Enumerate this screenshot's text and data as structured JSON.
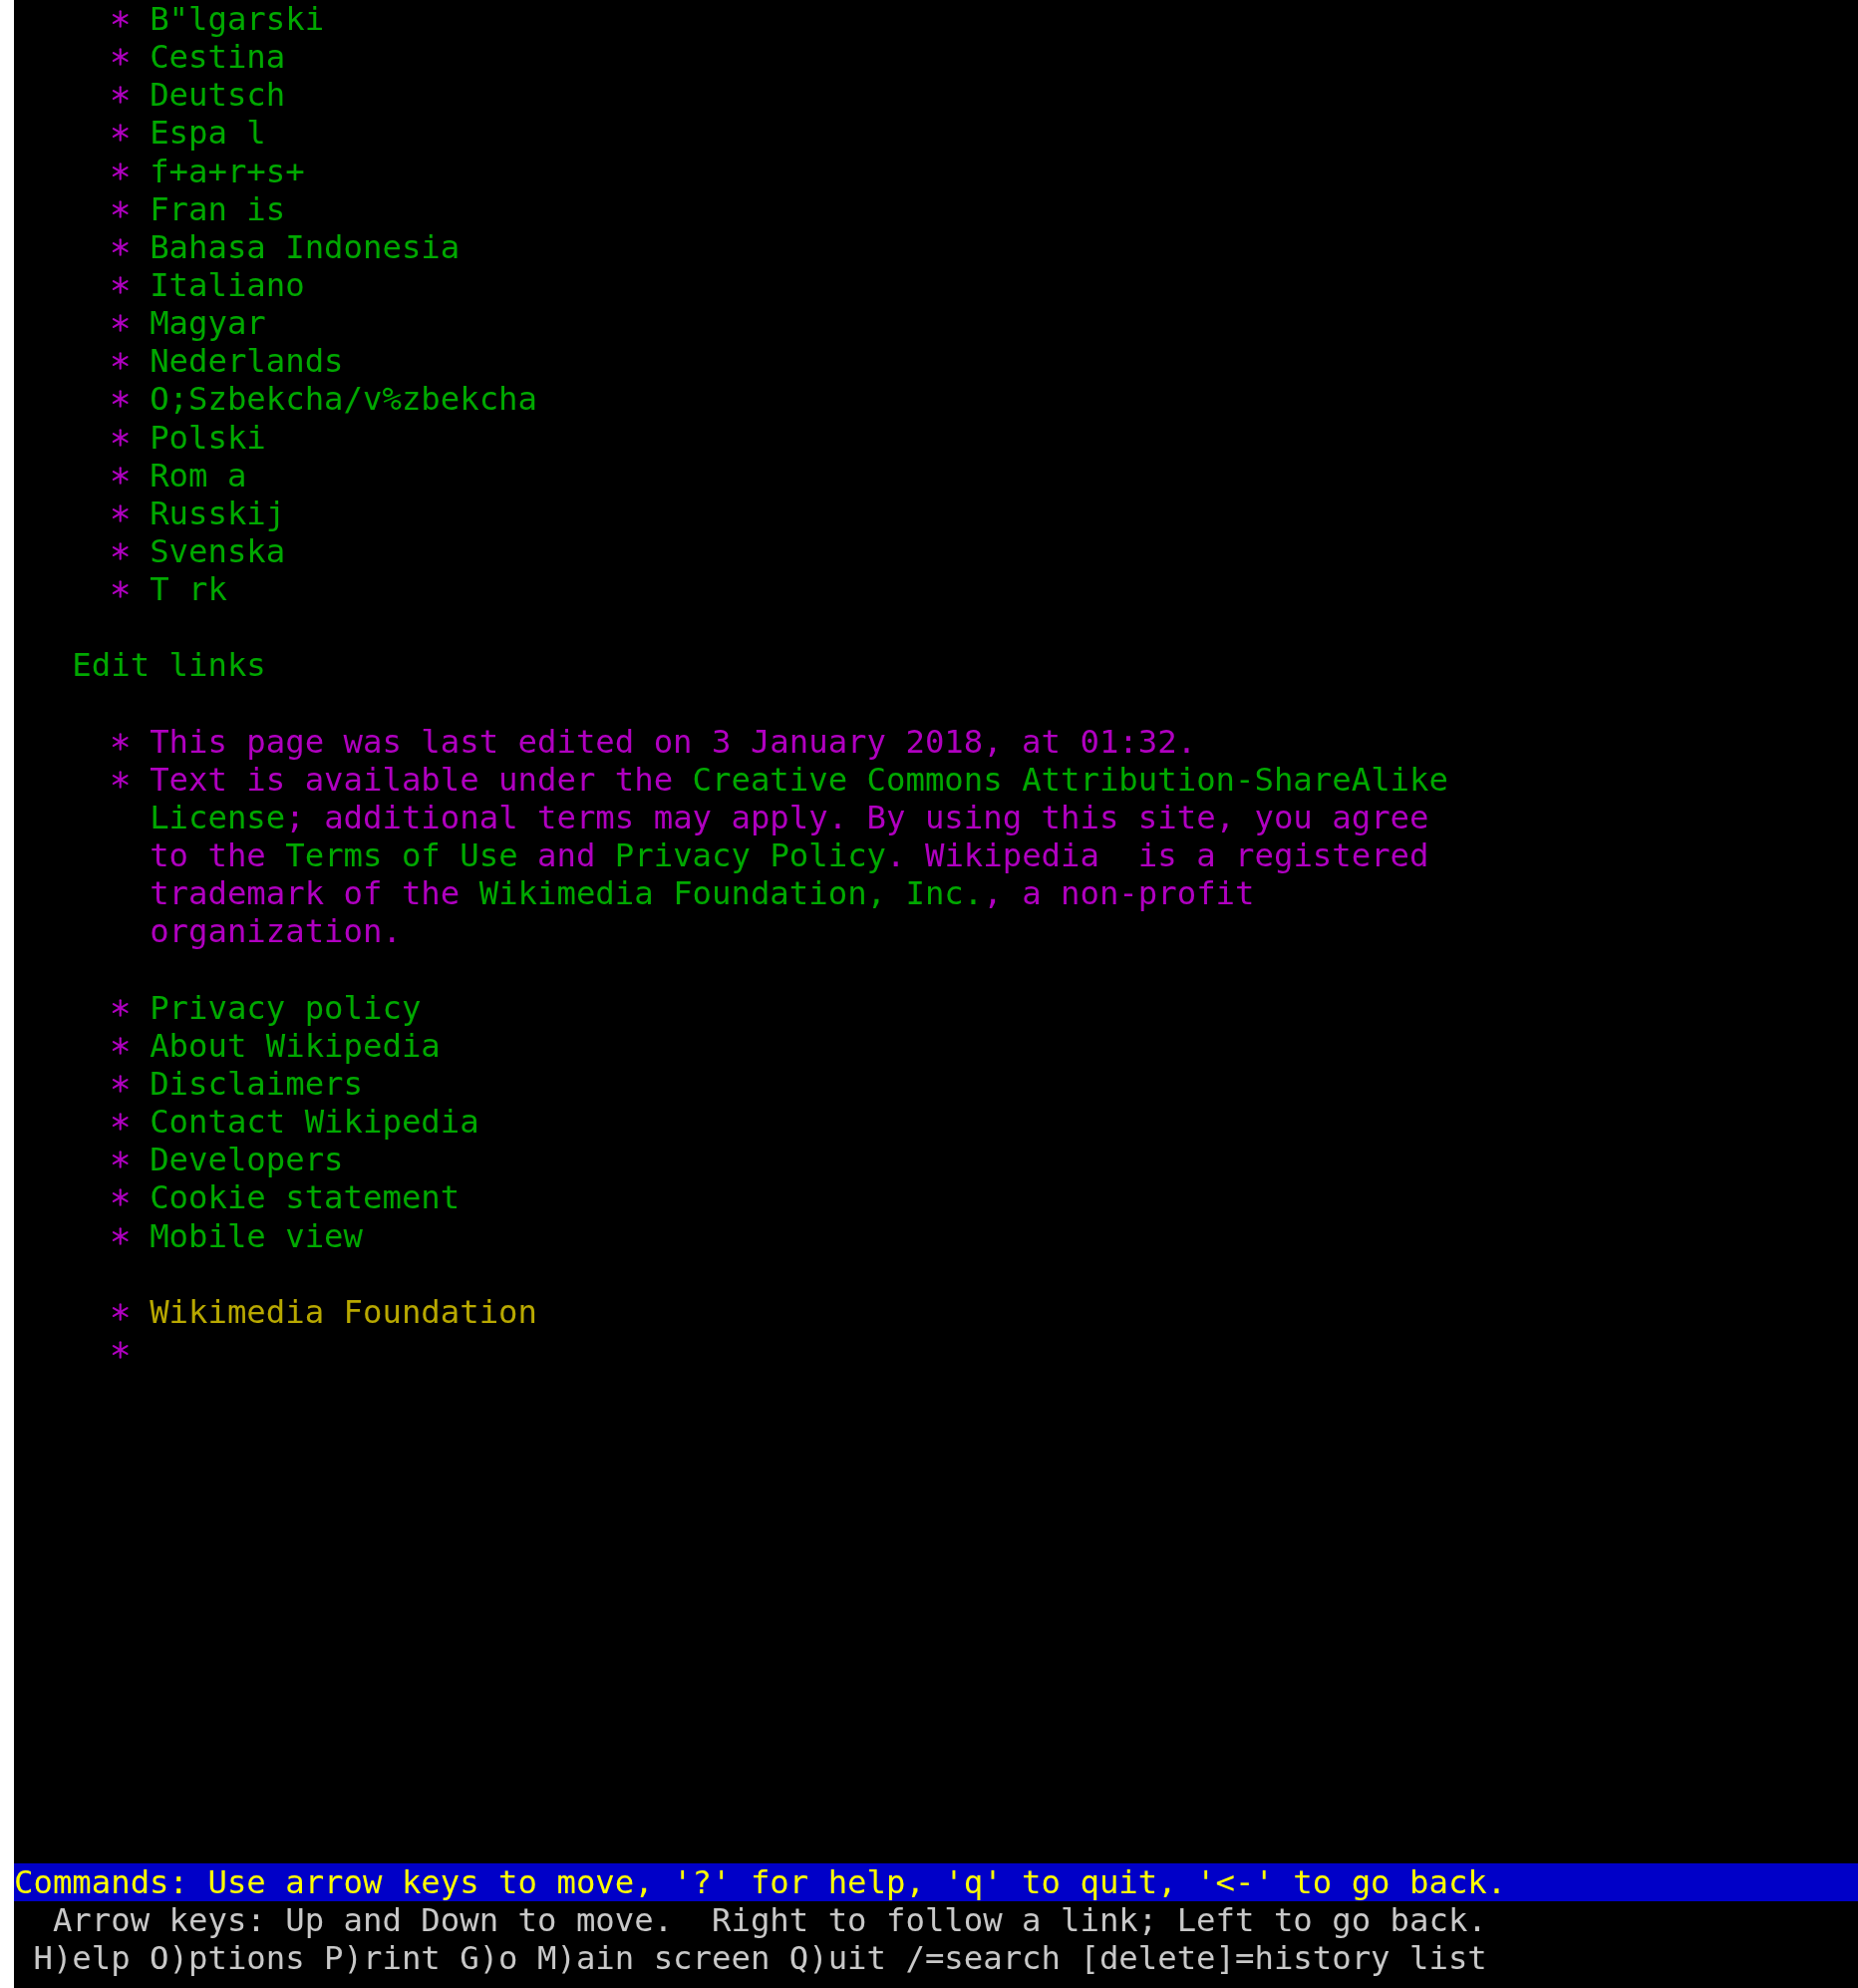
{
  "language_links": [
    "B\"lgarski",
    "Cestina",
    "Deutsch",
    "Espa l",
    "f+a+r+s+",
    "Fran is",
    "Bahasa Indonesia",
    "Italiano",
    "Magyar",
    "Nederlands",
    "O;Szbekcha/v%zbekcha",
    "Polski",
    "Rom a",
    "Russkij",
    "Svenska",
    "T rk"
  ],
  "edit_links": "Edit links",
  "footer_notes": [
    {
      "lines": [
        [
          {
            "kind": "text",
            "text": "This page was last edited on 3 January 2018, at 01:32."
          }
        ]
      ]
    },
    {
      "lines": [
        [
          {
            "kind": "text",
            "text": "Text is available under the "
          },
          {
            "kind": "link",
            "text": "Creative Commons Attribution-ShareAlike"
          }
        ],
        [
          {
            "kind": "link",
            "text": "License"
          },
          {
            "kind": "text",
            "text": "; additional terms may apply. By using this site, you agree"
          }
        ],
        [
          {
            "kind": "text",
            "text": "to the "
          },
          {
            "kind": "link",
            "text": "Terms of Use"
          },
          {
            "kind": "text",
            "text": " and "
          },
          {
            "kind": "link",
            "text": "Privacy Policy"
          },
          {
            "kind": "text",
            "text": ". Wikipedia  is a registered"
          }
        ],
        [
          {
            "kind": "text",
            "text": "trademark of the "
          },
          {
            "kind": "link",
            "text": "Wikimedia Foundation, Inc."
          },
          {
            "kind": "text",
            "text": ", a non-profit"
          }
        ],
        [
          {
            "kind": "text",
            "text": "organization."
          }
        ]
      ]
    }
  ],
  "footer_links": [
    "Privacy policy",
    "About Wikipedia",
    "Disclaimers",
    "Contact Wikipedia",
    "Developers",
    "Cookie statement",
    "Mobile view"
  ],
  "wikimedia_links": [
    {
      "kind": "highlighted",
      "label": "Wikimedia Foundation"
    },
    {
      "kind": "image"
    }
  ],
  "status_bar": {
    "commands": "Commands: Use arrow keys to move, '?' for help, 'q' to quit, '<-' to go back.",
    "help_line": "Arrow keys: Up and Down to move.  Right to follow a link; Left to go back.",
    "keys_line": "H)elp O)ptions P)rint G)o M)ain screen Q)uit /=search [delete]=history list"
  }
}
